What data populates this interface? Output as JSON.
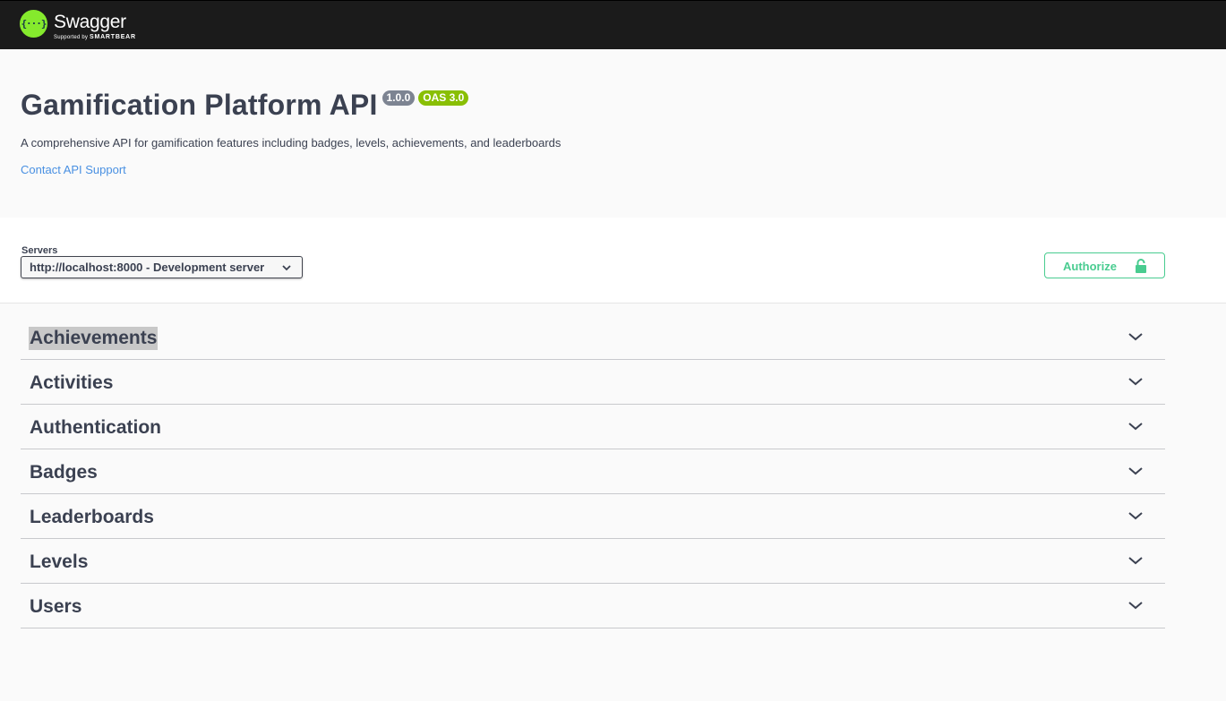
{
  "topbar": {
    "logo_word": "Swagger",
    "logo_mark": "{···}",
    "logo_sub_prefix": "Supported by",
    "logo_sub_brand": "SMARTBEAR"
  },
  "info": {
    "title": "Gamification Platform API",
    "version_badge": "1.0.0",
    "oas_badge": "OAS 3.0",
    "description": "A comprehensive API for gamification features including badges, levels, achievements, and leaderboards",
    "contact_link": "Contact API Support"
  },
  "scheme": {
    "servers_label": "Servers",
    "selected_server": "http://localhost:8000 - Development server",
    "authorize_label": "Authorize"
  },
  "tags": [
    {
      "name": "Achievements"
    },
    {
      "name": "Activities"
    },
    {
      "name": "Authentication"
    },
    {
      "name": "Badges"
    },
    {
      "name": "Leaderboards"
    },
    {
      "name": "Levels"
    },
    {
      "name": "Users"
    }
  ],
  "colors": {
    "topbar": "#1b1b1b",
    "logo_green": "#85ea2d",
    "version_badge": "#7d8492",
    "oas_badge": "#89bf04",
    "link": "#4990e2",
    "authorize": "#49cc90"
  },
  "icons": [
    "swagger-logo-icon",
    "chevron-down-icon",
    "lock-icon"
  ]
}
